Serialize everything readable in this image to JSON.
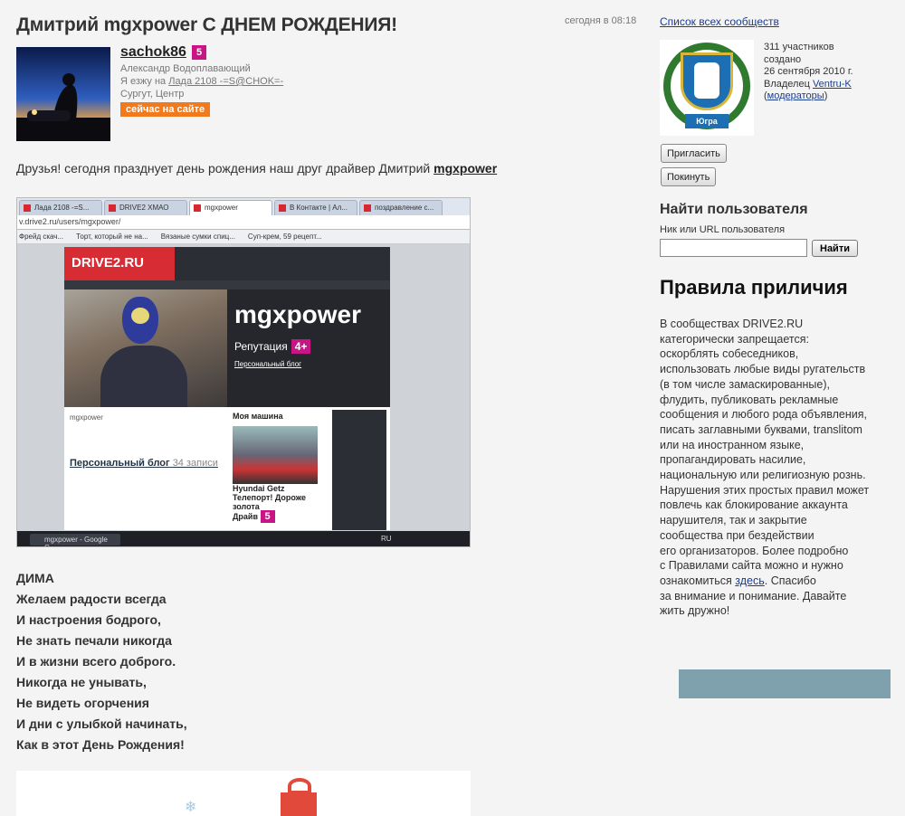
{
  "post": {
    "title": "Дмитрий mgxpower С ДНЕМ РОЖДЕНИЯ!",
    "time": "сегодня в 08:18"
  },
  "author": {
    "nick": "sachok86",
    "badge": "5",
    "name": "Александр Водоплавающий",
    "drive_prefix": "Я езжу на",
    "drive_car": "Лада 2108 -=S@CHOK=-",
    "location": "Сургут, Центр",
    "online": "сейчас на сайте"
  },
  "intro": {
    "text": "Друзья! сегодня празднует день рождения наш друг драйвер Дмитрий",
    "link": "mgxpower"
  },
  "screenshot": {
    "tabs": [
      "Лада 2108 -=S...",
      "DRIVE2 ХМАО",
      "mgxpower",
      "В Контакте | Ал...",
      "поздравление с..."
    ],
    "url": "v.drive2.ru/users/mgxpower/",
    "bookmarks": [
      "Фрейд скач...",
      "Торт, который не на...",
      "Вязаные сумки спиц...",
      "Суп-крем, 59 рецепт..."
    ],
    "site_logo": "DRIVE2.RU",
    "hero_name": "mgxpower",
    "reputation": "Репутация",
    "reputation_value": "4+",
    "blog_link": "Персональный блог",
    "my_car_title": "Моя машина",
    "user_nick": "mgxpower",
    "blog_title": "Персональный блог",
    "blog_count": "34 записи",
    "car_name": "Hyundai Getz Телепорт! Дороже золота",
    "car_drive": "Драйв",
    "car_drive_badge": "5",
    "task_label": "mgxpower - Google C...",
    "lang": "RU"
  },
  "poem": [
    "ДИМА",
    "Желаем радости всегда",
    "И настроения бодрого,",
    "Не знать печали никогда",
    "И в жизни всего доброго.",
    "Никогда не унывать,",
    "Не видеть огорчения",
    "И дни с улыбкой начинать,",
    "Как в этот День Рождения!"
  ],
  "sidebar": {
    "all_link": "Список всех сообществ",
    "emblem_text": "Югра",
    "members": "311 участников",
    "created_label": "создано",
    "created_date": "26 сентября 2010 г.",
    "owner_label": "Владелец",
    "owner_name": "Ventru-K",
    "moderators_link": "модераторы",
    "invite_btn": "Пригласить",
    "leave_btn": "Покинуть",
    "find_title": "Найти пользователя",
    "find_label": "Ник или URL пользователя",
    "find_value": "",
    "find_btn": "Найти",
    "rules_title": "Правила приличия",
    "rules_lines": [
      "В сообществах DRIVE2.RU",
      "категорически запрещается:",
      "оскорблять собеседников,",
      "использовать любые виды ругательств",
      "(в том числе замаскированные),",
      "флудить, публиковать рекламные",
      "сообщения и любого рода объявления,",
      "писать заглавными буквами, translitom",
      "или на иностранном языке,",
      "пропагандировать насилие,",
      "национальную или религиозную рознь.",
      "Нарушения этих простых правил может",
      "повлечь как блокирование аккаунта",
      "нарушителя, так и закрытие",
      "сообщества при бездействии",
      "его организаторов. Более подробно",
      "с Правилами сайта можно и нужно"
    ],
    "rules_link_prefix": "ознакомиться",
    "rules_link": "здесь",
    "rules_link_suffix": ". Спасибо",
    "rules_tail": [
      "за внимание и понимание. Давайте",
      "жить дружно!"
    ]
  }
}
